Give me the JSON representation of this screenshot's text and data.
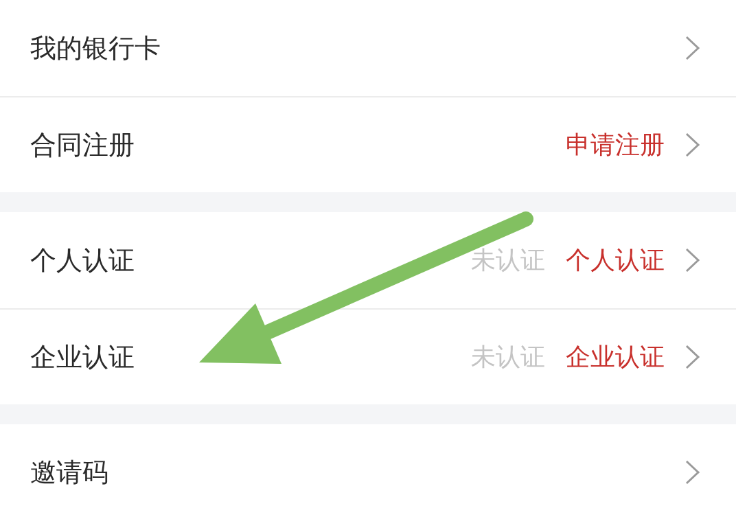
{
  "groups": [
    {
      "rows": [
        {
          "label": "我的银行卡"
        },
        {
          "label": "合同注册",
          "action": "申请注册"
        }
      ]
    },
    {
      "rows": [
        {
          "label": "个人认证",
          "status": "未认证",
          "action": "个人认证"
        },
        {
          "label": "企业认证",
          "status": "未认证",
          "action": "企业认证"
        }
      ]
    },
    {
      "rows": [
        {
          "label": "邀请码"
        }
      ]
    }
  ],
  "annotations": [
    {
      "kind": "arrow"
    }
  ]
}
